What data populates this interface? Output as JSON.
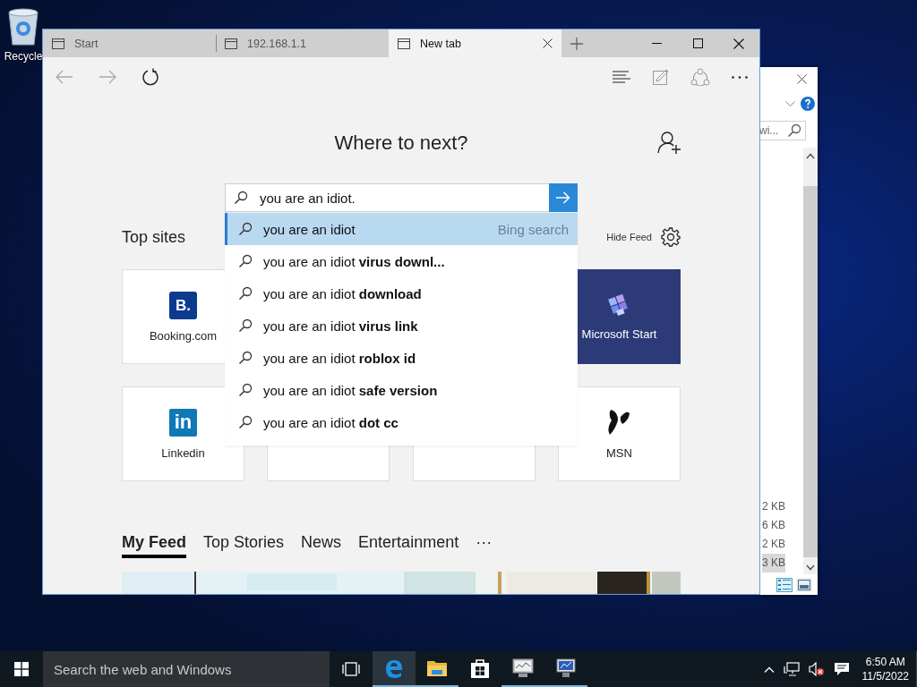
{
  "desktop": {
    "icons": [
      {
        "label": "Recycle"
      }
    ]
  },
  "explorer_window": {
    "search": {
      "value": "wi..."
    },
    "sizes": [
      {
        "text": "2 KB",
        "selected": false
      },
      {
        "text": "6 KB",
        "selected": false
      },
      {
        "text": "2 KB",
        "selected": false
      },
      {
        "text": "3 KB",
        "selected": true
      }
    ],
    "view_buttons": [
      {
        "kind": "details",
        "selected": true
      },
      {
        "kind": "preview",
        "selected": false
      }
    ]
  },
  "browser": {
    "tabs": [
      {
        "label": "Start",
        "selected": false
      },
      {
        "label": "192.168.1.1",
        "selected": false
      },
      {
        "label": "New tab",
        "selected": true
      }
    ],
    "heading": "Where to next?",
    "search": {
      "value": "you are an idiot."
    },
    "suggestions": [
      {
        "text": "you are an idiot",
        "hint": "Bing search",
        "selected": true
      },
      {
        "text": "you are an idiot **virus downl...**",
        "selected": false
      },
      {
        "text": "you are an idiot **download**",
        "selected": false
      },
      {
        "text": "you are an idiot **virus link**",
        "selected": false
      },
      {
        "text": "you are an idiot **roblox id**",
        "selected": false
      },
      {
        "text": "you are an idiot **safe version**",
        "selected": false
      },
      {
        "text": "you are an idiot **dot cc**",
        "selected": false
      }
    ],
    "top_sites_title": "Top sites",
    "hide_feed": "Hide Feed",
    "top_sites": [
      {
        "kind": "booking",
        "label": "Booking.com",
        "logo_text": "B."
      },
      {
        "kind": "covered"
      },
      {
        "kind": "covered"
      },
      {
        "kind": "start",
        "label": "Microsoft Start"
      },
      {
        "kind": "linkedin",
        "label": "Linkedin",
        "logo_text": "in"
      },
      {
        "kind": "blank"
      },
      {
        "kind": "blank"
      },
      {
        "kind": "msn",
        "label": "MSN"
      }
    ],
    "feed_tabs": [
      {
        "label": "My Feed",
        "selected": true
      },
      {
        "label": "Top Stories",
        "selected": false
      },
      {
        "label": "News",
        "selected": false
      },
      {
        "label": "Entertainment",
        "selected": false
      },
      {
        "label": "···",
        "selected": false
      }
    ]
  },
  "taskbar": {
    "search": {
      "placeholder": "Search the web and Windows"
    },
    "apps": [
      {
        "kind": "browser",
        "active": true,
        "running": true
      },
      {
        "kind": "folder",
        "active": false,
        "running": true
      },
      {
        "kind": "store",
        "active": false,
        "running": false
      },
      {
        "kind": "monitor",
        "active": false,
        "running": true
      },
      {
        "kind": "computer",
        "active": false,
        "running": true
      }
    ],
    "time": "6:50 AM",
    "date": "11/5/2022"
  }
}
